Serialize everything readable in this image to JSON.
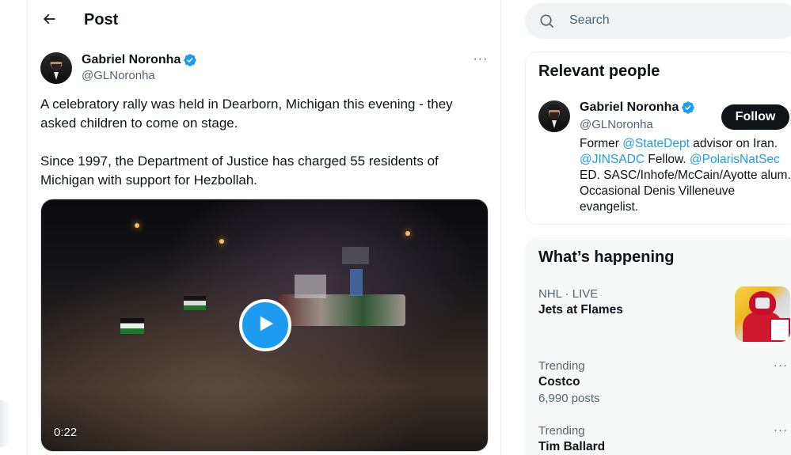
{
  "header": {
    "title": "Post"
  },
  "tweet": {
    "author_name": "Gabriel Noronha",
    "author_handle": "@GLNoronha",
    "more_label": "···",
    "text_paragraphs": [
      "A celebratory rally was held in Dearborn, Michigan this evening - they asked children to come on stage.",
      "Since 1997, the Department of Justice has charged 55 residents of Michigan with support for Hezbollah."
    ],
    "video": {
      "duration": "0:22"
    }
  },
  "search": {
    "placeholder": "Search"
  },
  "relevant_people": {
    "title": "Relevant people",
    "person": {
      "name": "Gabriel Noronha",
      "handle": "@GLNoronha",
      "follow_label": "Follow",
      "bio": {
        "t1": "Former ",
        "m1": "@StateDept",
        "t2": " advisor on Iran. ",
        "m2": "@JINSADC",
        "t3": " Fellow. ",
        "m3": "@PolarisNatSec",
        "t4": " ED. SASC/Inhofe/McCain/Ayotte alum. Occasional Denis Villeneuve evangelist."
      }
    }
  },
  "whats_happening": {
    "title": "What’s happening",
    "trends": [
      {
        "meta": "NHL · LIVE",
        "topic": "Jets at Flames"
      },
      {
        "meta": "Trending",
        "topic": "Costco",
        "count": "6,990 posts",
        "more": "···"
      },
      {
        "meta": "Trending",
        "topic": "Tim Ballard",
        "more": "···"
      }
    ]
  },
  "colors": {
    "accent": "#1d9bf0",
    "text_primary": "#0f1419",
    "text_secondary": "#536471",
    "follow_button_bg": "#0f1419",
    "search_bg": "#eff3f4",
    "card_bg": "#f7f9f9"
  },
  "icons": {
    "back": "arrow-left-icon",
    "verified": "verified-badge-icon",
    "search": "search-icon",
    "play": "play-icon",
    "more": "more-horizontal-icon"
  }
}
